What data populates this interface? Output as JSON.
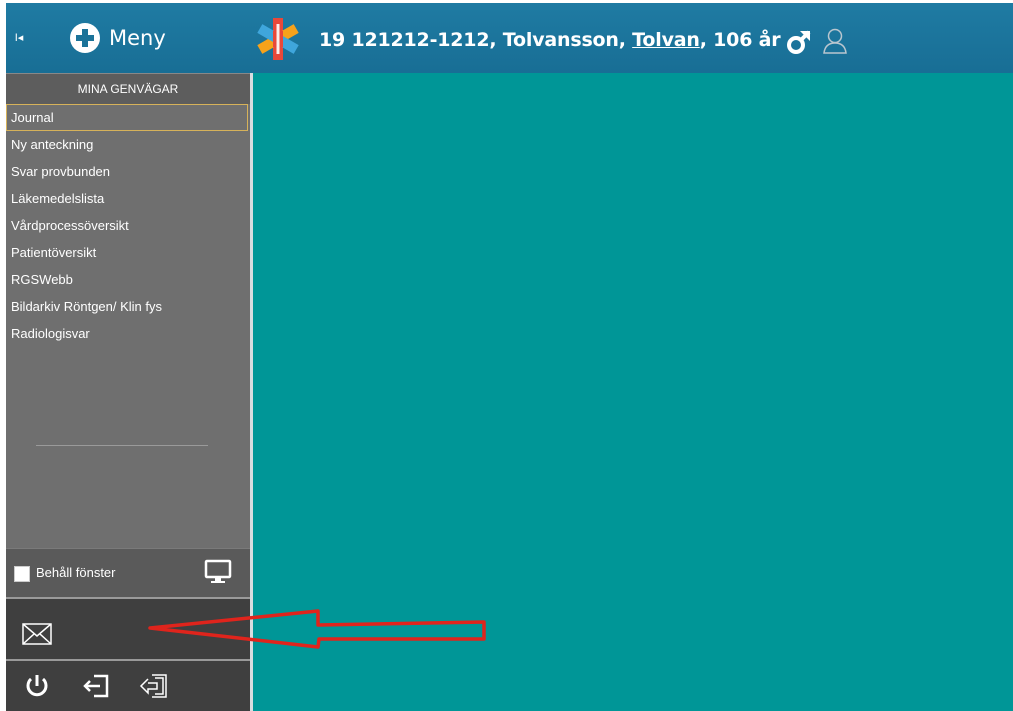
{
  "header": {
    "collapse_label": "I◂",
    "menu_label": "Meny",
    "patient_id": "19 121212-1212,",
    "surname": "Tolvansson,",
    "firstname": "Tolvan",
    "age": ", 106 år",
    "gender_icon": "male-icon",
    "person_icon": "person-icon"
  },
  "sidebar": {
    "title": "MINA GENVÄGAR",
    "items": [
      {
        "label": "Journal",
        "active": true
      },
      {
        "label": "Ny anteckning"
      },
      {
        "label": "Svar provbunden"
      },
      {
        "label": "Läkemedelslista"
      },
      {
        "label": "Vårdprocessöversikt"
      },
      {
        "label": "Patientöversikt"
      },
      {
        "label": "RGSWebb"
      },
      {
        "label": "Bildarkiv Röntgen/ Klin fys"
      },
      {
        "label": "Radiologisvar"
      }
    ],
    "keep_window_label": "Behåll fönster"
  },
  "colors": {
    "header_bg": "#1b7399",
    "sidebar_bg": "#6f6f6f",
    "main_bg": "#009697",
    "annotation_arrow": "#e0241c",
    "active_border": "#d6b25a"
  },
  "annotation": {
    "type": "arrow",
    "points_to": "mail-icon"
  }
}
